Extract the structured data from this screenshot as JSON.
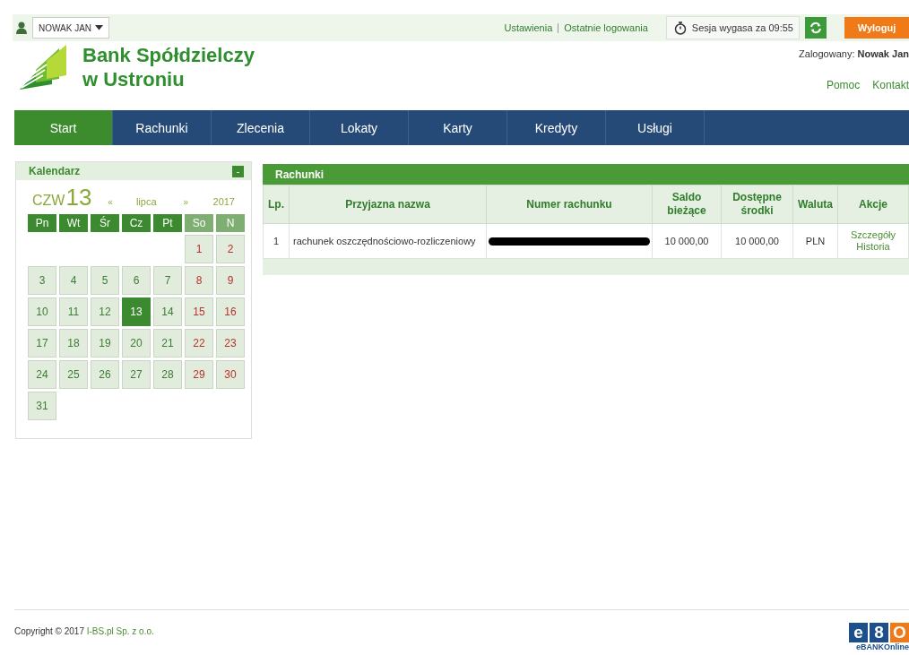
{
  "topbar": {
    "user_menu": "NOWAK JAN",
    "links": [
      "Ustawienia",
      "Ostatnie logowania"
    ],
    "session": "Sesja wygasa za 09:55",
    "logout": "Wyloguj"
  },
  "header": {
    "bank_name_line1": "Bank Spółdzielczy",
    "bank_name_line2": "w Ustroniu",
    "logged_label": "Zalogowany:",
    "logged_user": "Nowak Jan",
    "links": [
      "Pomoc",
      "Kontakt"
    ]
  },
  "nav": [
    {
      "label": "Start",
      "selected": true
    },
    {
      "label": "Rachunki",
      "selected": false
    },
    {
      "label": "Zlecenia",
      "selected": false
    },
    {
      "label": "Lokaty",
      "selected": false
    },
    {
      "label": "Karty",
      "selected": false
    },
    {
      "label": "Kredyty",
      "selected": false
    },
    {
      "label": "Usługi",
      "selected": false
    }
  ],
  "calendar": {
    "title": "Kalendarz",
    "collapse": "-",
    "weekday": "CZW",
    "day": "13",
    "prev": "«",
    "month": "lipca",
    "next": "»",
    "year": "2017",
    "headers": [
      {
        "label": "Pn",
        "weekend": false
      },
      {
        "label": "Wt",
        "weekend": false
      },
      {
        "label": "Śr",
        "weekend": false
      },
      {
        "label": "Cz",
        "weekend": false
      },
      {
        "label": "Pt",
        "weekend": false
      },
      {
        "label": "So",
        "weekend": true
      },
      {
        "label": "N",
        "weekend": true
      }
    ],
    "weeks": [
      [
        {
          "day": "1",
          "weekend": true,
          "selected": false
        },
        {
          "day": "2",
          "weekend": true,
          "selected": false
        }
      ],
      [
        {
          "day": "3",
          "weekend": false,
          "selected": false
        },
        {
          "day": "4",
          "weekend": false,
          "selected": false
        },
        {
          "day": "5",
          "weekend": false,
          "selected": false
        },
        {
          "day": "6",
          "weekend": false,
          "selected": false
        },
        {
          "day": "7",
          "weekend": false,
          "selected": false
        },
        {
          "day": "8",
          "weekend": true,
          "selected": false
        },
        {
          "day": "9",
          "weekend": true,
          "selected": false
        }
      ],
      [
        {
          "day": "10",
          "weekend": false,
          "selected": false
        },
        {
          "day": "11",
          "weekend": false,
          "selected": false
        },
        {
          "day": "12",
          "weekend": false,
          "selected": false
        },
        {
          "day": "13",
          "weekend": false,
          "selected": true
        },
        {
          "day": "14",
          "weekend": false,
          "selected": false
        },
        {
          "day": "15",
          "weekend": true,
          "selected": false
        },
        {
          "day": "16",
          "weekend": true,
          "selected": false
        }
      ],
      [
        {
          "day": "17",
          "weekend": false,
          "selected": false
        },
        {
          "day": "18",
          "weekend": false,
          "selected": false
        },
        {
          "day": "19",
          "weekend": false,
          "selected": false
        },
        {
          "day": "20",
          "weekend": false,
          "selected": false
        },
        {
          "day": "21",
          "weekend": false,
          "selected": false
        },
        {
          "day": "22",
          "weekend": true,
          "selected": false
        },
        {
          "day": "23",
          "weekend": true,
          "selected": false
        }
      ],
      [
        {
          "day": "24",
          "weekend": false,
          "selected": false
        },
        {
          "day": "25",
          "weekend": false,
          "selected": false
        },
        {
          "day": "26",
          "weekend": false,
          "selected": false
        },
        {
          "day": "27",
          "weekend": false,
          "selected": false
        },
        {
          "day": "28",
          "weekend": false,
          "selected": false
        },
        {
          "day": "29",
          "weekend": true,
          "selected": false
        },
        {
          "day": "30",
          "weekend": true,
          "selected": false
        }
      ],
      [
        {
          "day": "31",
          "weekend": false,
          "selected": false
        }
      ]
    ]
  },
  "accounts": {
    "title": "Rachunki",
    "columns": [
      "Lp.",
      "Przyjazna nazwa",
      "Numer rachunku",
      "Saldo bieżące",
      "Dostępne środki",
      "Waluta",
      "Akcje"
    ],
    "rows": [
      {
        "lp": "1",
        "name": "rachunek oszczędnościowo-rozliczeniowy",
        "number_redacted": true,
        "balance": "10 000,00",
        "available": "10 000,00",
        "currency": "PLN",
        "actions": [
          "Szczegóły",
          "Historia"
        ]
      }
    ]
  },
  "footer": {
    "copyright": "Copyright © 2017",
    "company": "I-BS.pl Sp. z o.o.",
    "logo_letters": [
      "e",
      "8",
      "O"
    ],
    "logo_caption": "eBANKOnline"
  }
}
